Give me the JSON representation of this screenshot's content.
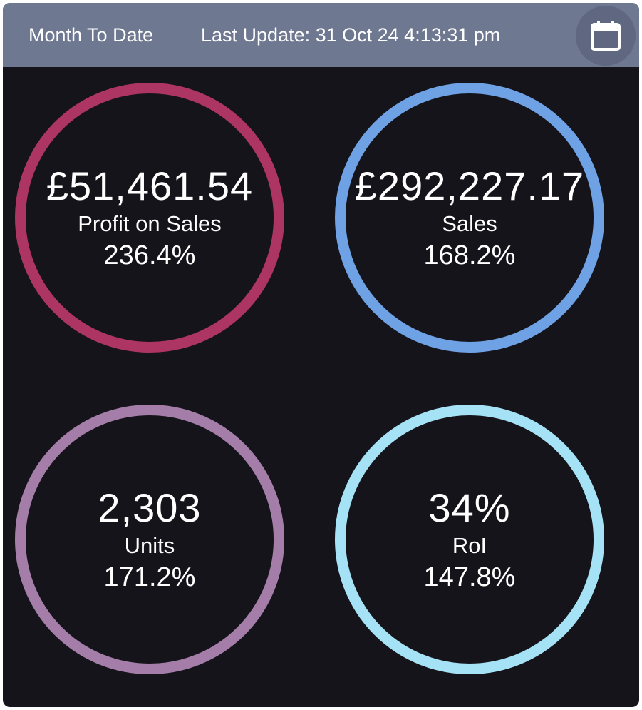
{
  "header": {
    "period": "Month To Date",
    "last_update": "Last Update: 31 Oct 24 4:13:31 pm",
    "calendar_icon": "calendar-icon"
  },
  "colors": {
    "header_bg": "#6f7891",
    "panel_bg": "#15141b",
    "profit_ring": "#ad3563",
    "sales_ring": "#6fa1e5",
    "units_ring": "#a47ea8",
    "roi_ring": "#a6e2f5",
    "text": "#ffffff"
  },
  "kpis": {
    "profit": {
      "value": "£51,461.54",
      "label": "Profit on Sales",
      "change": "236.4%"
    },
    "sales": {
      "value": "£292,227.17",
      "label": "Sales",
      "change": "168.2%"
    },
    "units": {
      "value": "2,303",
      "label": "Units",
      "change": "171.2%"
    },
    "roi": {
      "value": "34%",
      "label": "RoI",
      "change": "147.8%"
    }
  }
}
